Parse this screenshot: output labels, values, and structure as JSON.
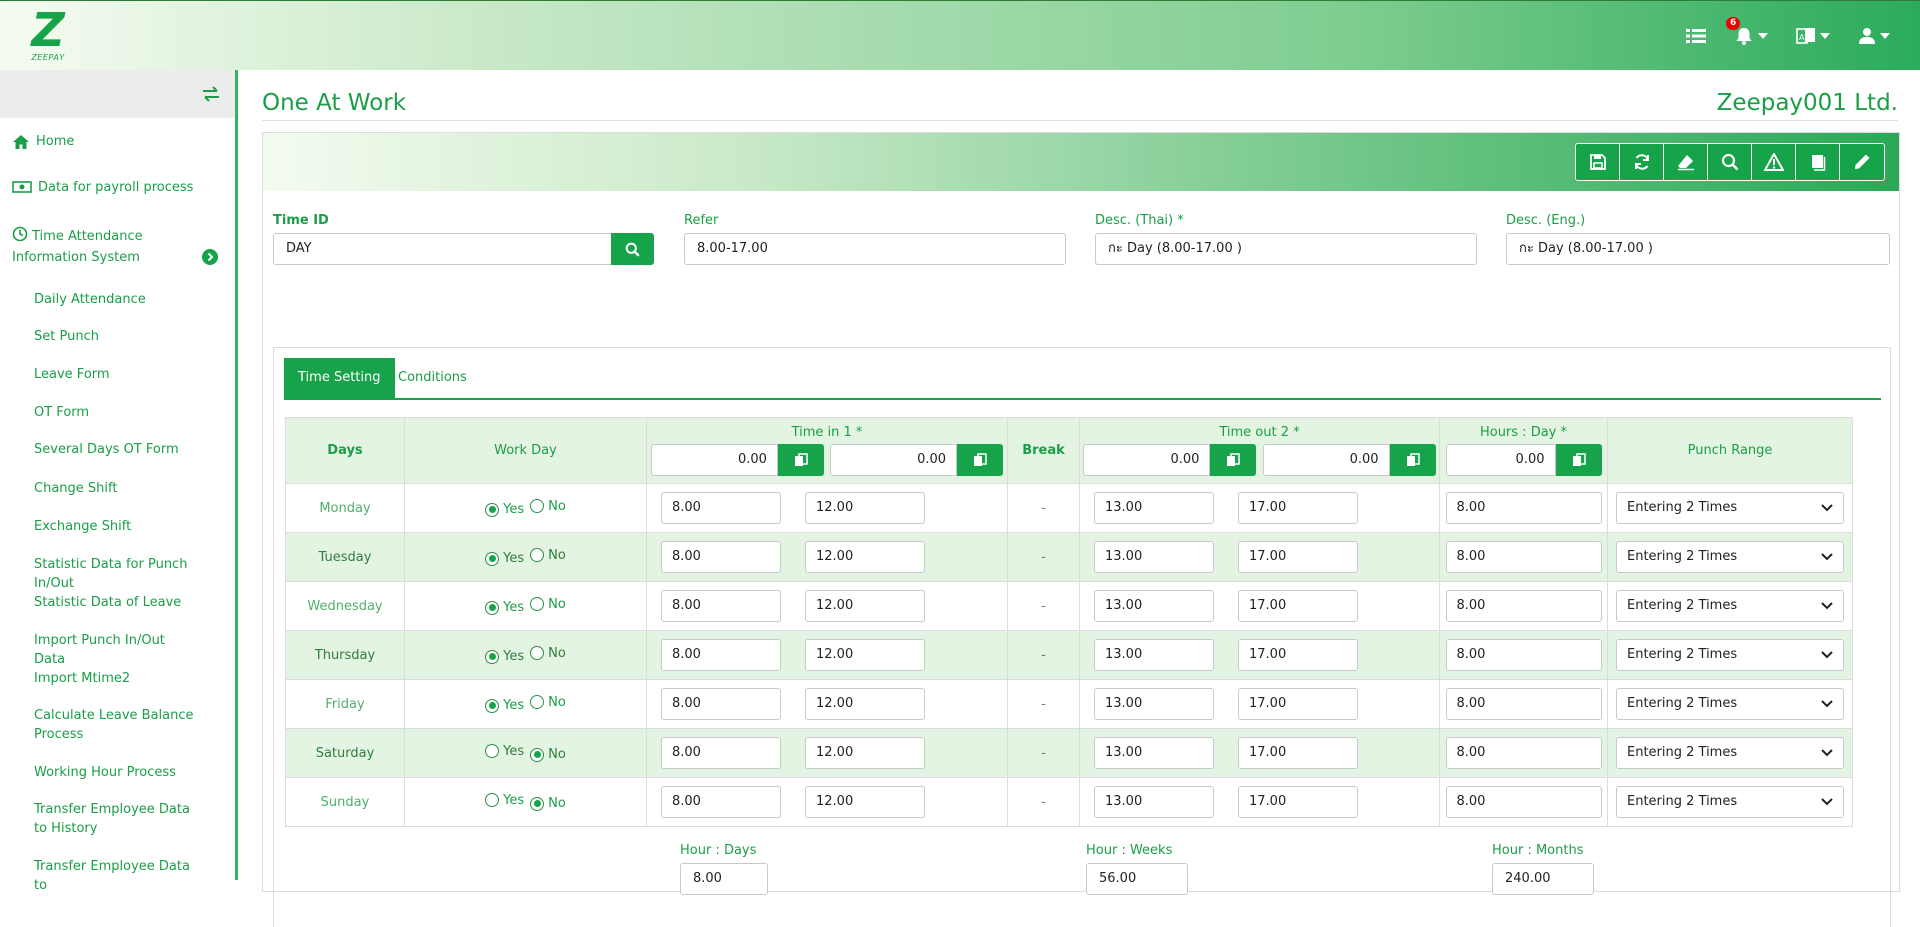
{
  "brand": {
    "logo_letter": "Z",
    "logo_text": "ZEEPAY"
  },
  "topbar": {
    "notification_count": "6",
    "icons": [
      "list-icon",
      "bell-icon",
      "language-icon",
      "user-icon"
    ]
  },
  "sidebar": {
    "items": [
      {
        "label": "Home",
        "icon": "home-icon"
      },
      {
        "label": "Data for payroll process",
        "icon": "money-icon"
      },
      {
        "label": "Time Attendance Information System",
        "icon": "clock-icon"
      }
    ],
    "subitems": [
      "Daily Attendance",
      "Set Punch",
      "Leave Form",
      "OT Form",
      "Several Days OT Form",
      "Change Shift",
      "Exchange Shift",
      "Statistic Data for Punch In/Out",
      "Statistic Data of Leave",
      "Import Punch In/Out Data",
      "Import Mtime2",
      "Calculate Leave Balance Process",
      "Working Hour Process",
      "Transfer Employee Data to History",
      "Transfer Employee Data to"
    ]
  },
  "page": {
    "title": "One At Work",
    "company": "Zeepay001 Ltd."
  },
  "form": {
    "time_id": {
      "label": "Time ID",
      "value": "DAY"
    },
    "refer": {
      "label": "Refer",
      "value": "8.00-17.00"
    },
    "desc_thai": {
      "label": "Desc. (Thai)",
      "required": "*",
      "value": "กะ Day (8.00-17.00 )"
    },
    "desc_eng": {
      "label": "Desc. (Eng.)",
      "value": "กะ Day (8.00-17.00 )"
    }
  },
  "tabs": {
    "time_setting": "Time Setting",
    "conditions": "Conditions"
  },
  "table": {
    "headers": {
      "days": "Days",
      "work_day": "Work Day",
      "time_in": "Time in 1",
      "break": "Break",
      "time_out": "Time out 2",
      "hours_day": "Hours : Day",
      "punch_range": "Punch Range",
      "required": "*"
    },
    "header_values": {
      "time_in_a": "0.00",
      "time_in_b": "0.00",
      "time_out_a": "0.00",
      "time_out_b": "0.00",
      "hours": "0.00"
    },
    "yes_label": "Yes",
    "no_label": "No",
    "break_value": "-",
    "rows": [
      {
        "day": "Monday",
        "work_day": "Yes",
        "in1": "8.00",
        "in2": "12.00",
        "out1": "13.00",
        "out2": "17.00",
        "hours": "8.00",
        "punch": "Entering 2 Times"
      },
      {
        "day": "Tuesday",
        "work_day": "Yes",
        "in1": "8.00",
        "in2": "12.00",
        "out1": "13.00",
        "out2": "17.00",
        "hours": "8.00",
        "punch": "Entering 2 Times"
      },
      {
        "day": "Wednesday",
        "work_day": "Yes",
        "in1": "8.00",
        "in2": "12.00",
        "out1": "13.00",
        "out2": "17.00",
        "hours": "8.00",
        "punch": "Entering 2 Times"
      },
      {
        "day": "Thursday",
        "work_day": "Yes",
        "in1": "8.00",
        "in2": "12.00",
        "out1": "13.00",
        "out2": "17.00",
        "hours": "8.00",
        "punch": "Entering 2 Times"
      },
      {
        "day": "Friday",
        "work_day": "Yes",
        "in1": "8.00",
        "in2": "12.00",
        "out1": "13.00",
        "out2": "17.00",
        "hours": "8.00",
        "punch": "Entering 2 Times"
      },
      {
        "day": "Saturday",
        "work_day": "No",
        "in1": "8.00",
        "in2": "12.00",
        "out1": "13.00",
        "out2": "17.00",
        "hours": "8.00",
        "punch": "Entering 2 Times"
      },
      {
        "day": "Sunday",
        "work_day": "No",
        "in1": "8.00",
        "in2": "12.00",
        "out1": "13.00",
        "out2": "17.00",
        "hours": "8.00",
        "punch": "Entering 2 Times"
      }
    ]
  },
  "totals": {
    "hour_days": {
      "label": "Hour : Days",
      "value": "8.00"
    },
    "hour_weeks": {
      "label": "Hour : Weeks",
      "value": "56.00"
    },
    "hour_months": {
      "label": "Hour : Months",
      "value": "240.00"
    }
  },
  "colors": {
    "primary": "#17a34a",
    "text_green": "#1a9e47",
    "row_alt": "#e4f4e2"
  }
}
